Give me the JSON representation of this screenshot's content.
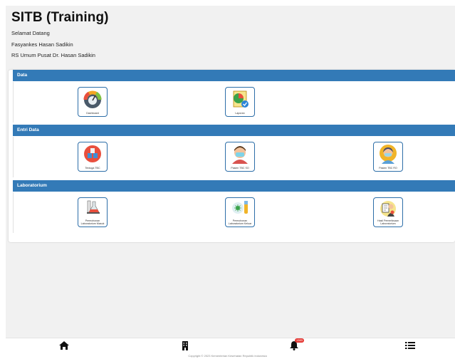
{
  "header": {
    "title": "SITB (Training)",
    "lines": [
      "Selamat Datang",
      "Fasyankes Hasan Sadikin",
      "RS Umum Pusat Dr. Hasan Sadikin"
    ]
  },
  "sections": [
    {
      "title": "Data",
      "items": [
        {
          "label": "Dashboard",
          "icon": "dashboard-gauge-icon"
        },
        {
          "label": "Laporan",
          "icon": "report-chart-icon"
        }
      ]
    },
    {
      "title": "Entri Data",
      "items": [
        {
          "label": "Terduga TBC",
          "icon": "suspect-blocks-icon"
        },
        {
          "label": "Pasien TBC SO",
          "icon": "patient-masked-man-icon"
        },
        {
          "label": "Pasien TBC RO",
          "icon": "patient-masked-woman-icon"
        }
      ]
    },
    {
      "title": "Laboratorium",
      "items": [
        {
          "label": "Permohonan Laboratorium Masuk",
          "icon": "lab-flasks-icon"
        },
        {
          "label": "Permohonan Laboratorium Keluar",
          "icon": "test-tube-virus-icon"
        },
        {
          "label": "Hasil Pemeriksaan Laboratorium",
          "icon": "lab-result-doctor-icon"
        }
      ]
    }
  ],
  "bottom_nav": {
    "items": [
      "home-icon",
      "building-icon",
      "bell-icon",
      "list-icon"
    ],
    "notification_count": "1383"
  },
  "footer": {
    "text": "Copyright © 2023 Kementerian Kesehatan Republik Indonesia"
  },
  "colors": {
    "section_header": "#337ab7",
    "tile_border": "#2d6ea8",
    "badge": "#e53935"
  }
}
